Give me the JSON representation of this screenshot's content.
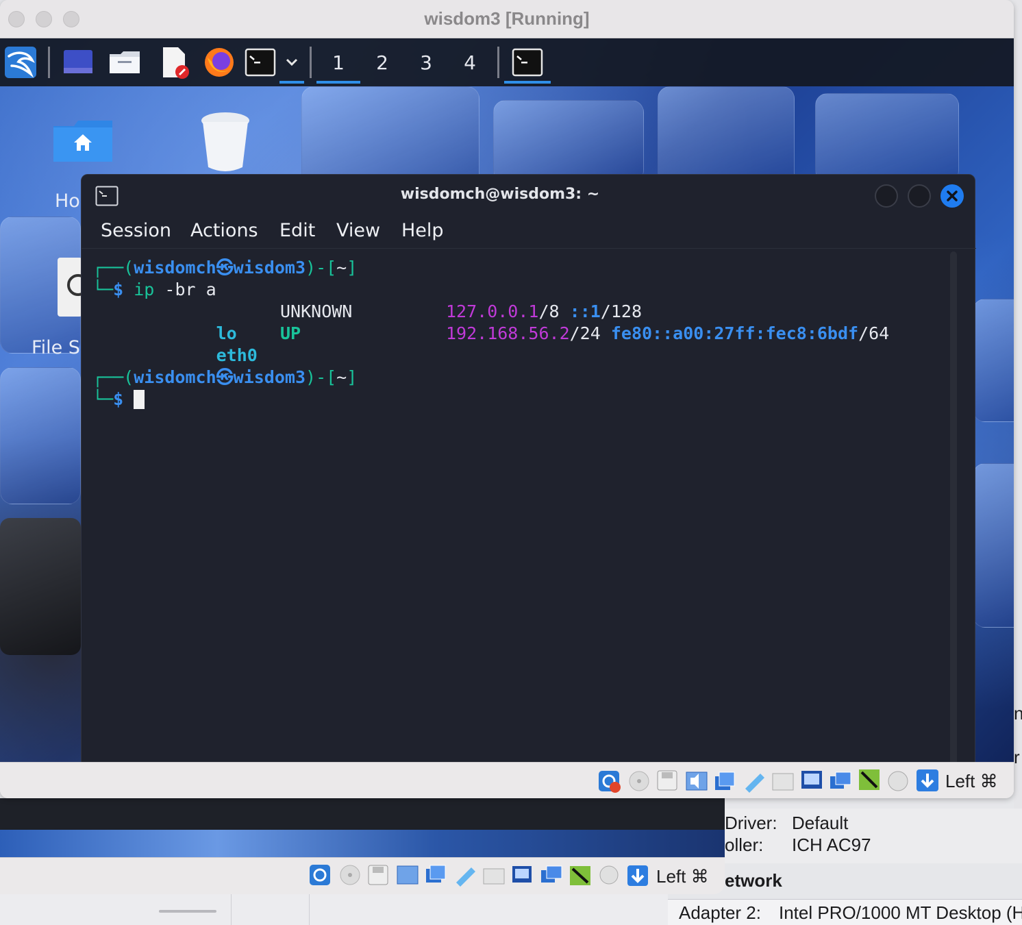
{
  "vm_window": {
    "title": "wisdom3 [Running]"
  },
  "kali_panel": {
    "workspaces": [
      "1",
      "2",
      "3",
      "4"
    ]
  },
  "desktop": {
    "home_label": "Ho",
    "filesystem_label": "File S"
  },
  "terminal": {
    "title": "wisdomch@wisdom3: ~",
    "menu": [
      "Session",
      "Actions",
      "Edit",
      "View",
      "Help"
    ],
    "prompt": {
      "open": "┌──(",
      "user": "wisdomch",
      "at": "㉿",
      "host": "wisdom3",
      "close": ")-[",
      "dir": "~",
      "end": "]",
      "corner": "└─",
      "dollar": "$"
    },
    "command": {
      "name": "ip",
      "args": " -br a"
    },
    "interfaces": [
      {
        "name": "lo",
        "state": "UNKNOWN",
        "ipv4": "127.0.0.1",
        "ipv4_mask": "/8",
        "ipv6": "::1",
        "ipv6_mask": "/128"
      },
      {
        "name": "eth0",
        "state": "UP",
        "ipv4": "192.168.56.2",
        "ipv4_mask": "/24",
        "ipv6": "fe80::a00:27ff:fec8:6bdf",
        "ipv6_mask": "/64"
      }
    ]
  },
  "statusbar": {
    "host_key": "Left ⌘"
  },
  "host_manager": {
    "driver_label": "Driver:",
    "driver_value": "Default",
    "controller_label": "oller:",
    "controller_value": "ICH AC97",
    "network_heading": "etwork",
    "adapter_label": "Adapter 2:",
    "adapter_value": "Intel PRO/1000 MT Desktop (H",
    "edge_char_1": "n",
    "edge_char_2": "r"
  },
  "colors": {
    "terminal_bg": "#1f222d",
    "prompt_blue": "#3a8ff0",
    "prompt_green": "#19c39a",
    "ip_magenta": "#c03ad8",
    "close_button": "#1f7cf0"
  }
}
